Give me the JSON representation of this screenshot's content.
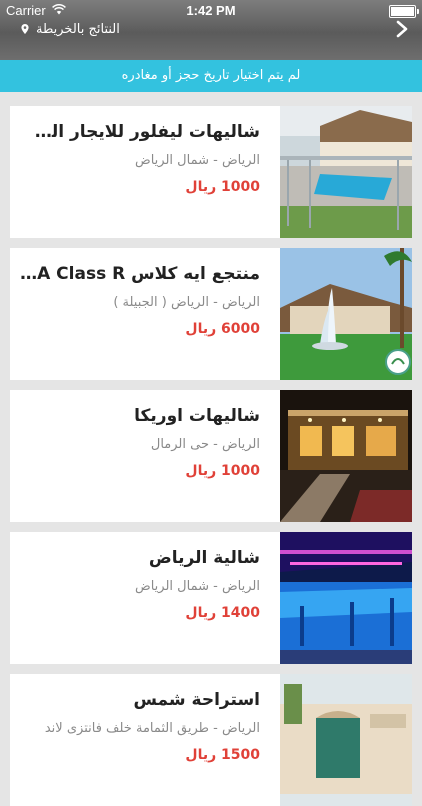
{
  "status_bar": {
    "carrier": "Carrier",
    "time": "1:42 PM"
  },
  "header": {
    "map_link_label": "النتائج بالخريطة",
    "back_icon": "chevron-right-icon",
    "map_icon": "map-pin-icon"
  },
  "banner": {
    "text": "لم يتم اختيار تاريخ حجز أو مغادره",
    "color": "#33c2df"
  },
  "colors": {
    "price": "#e04138",
    "background": "#e5e5e5"
  },
  "listings": [
    {
      "title": "شاليهات ليفلور للايجار الي ...",
      "location": "الرياض - شمال الرياض",
      "price": "1000 ريال"
    },
    {
      "title": "منتجع ايه كلاس A Class R...",
      "location": "الرياض - الرياض ( الجبيلة )",
      "price": "6000 ريال"
    },
    {
      "title": "شاليهات اوريكا",
      "location": "الرياض - حى الرمال",
      "price": "1000 ريال"
    },
    {
      "title": "شالية الرياض",
      "location": "الرياض - شمال الرياض",
      "price": "1400 ريال"
    },
    {
      "title": "استراحة شمس",
      "location": "الرياض - طريق الثمامة خلف فانتزى لاند",
      "price": "1500 ريال"
    }
  ]
}
